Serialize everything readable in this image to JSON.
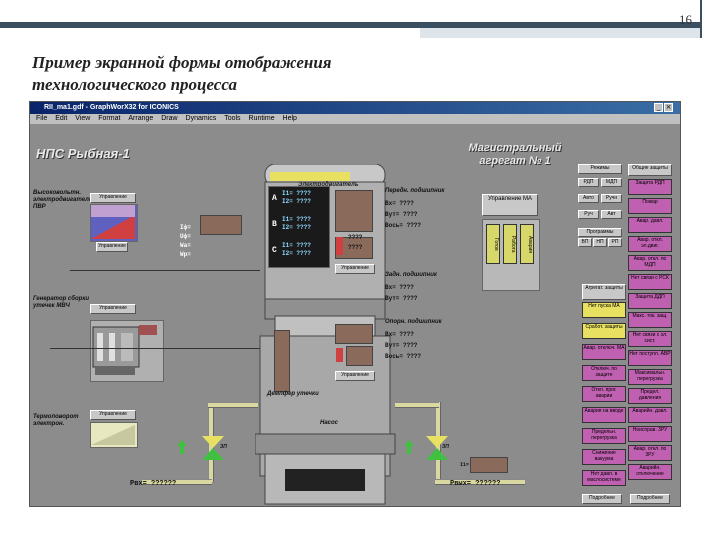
{
  "slide": {
    "number": "16",
    "title_line1": "Пример экранной формы отображения",
    "title_line2": "технологического процесса"
  },
  "window": {
    "title": "RII_ma1.gdf - GraphWorX32 for ICONICS"
  },
  "menu": [
    "File",
    "Edit",
    "View",
    "Format",
    "Arrange",
    "Draw",
    "Dynamics",
    "Tools",
    "Runtime",
    "Help"
  ],
  "labels": {
    "station": "НПС Рыбная-1",
    "aggregate": "Магистральный агрегат № 1",
    "electromotor": "Электродвигатель",
    "pump": "Насос",
    "bearing_front": "Передн. подшипник",
    "bearing_rear": "Задн. подшипник",
    "bearing_opor": "Опорн. подшипник",
    "damper": "Демпфер утечки",
    "left1": "Высоковольтн. электродвигатель ПВР",
    "left2": "Генератор сборки утечек МВЧ",
    "left3": "Термоповорот электрон.",
    "rvx": "Рвх= ??????",
    "rvyx": "Рвых= ??????",
    "control": "Управление",
    "control_ma": "Управление МА",
    "unknown": "????",
    "hint": "I1=",
    "pipe_label": "ЗП",
    "pipe_label2": "ЗП"
  },
  "electro_vals": {
    "I": "Iф=",
    "U": "Uф=",
    "W": "Wa=",
    "Wp": "Wp="
  },
  "phases": [
    {
      "name": "A",
      "v1": "I1= ????",
      "v2": "I2= ????"
    },
    {
      "name": "B",
      "v1": "I1= ????",
      "v2": "I2= ????"
    },
    {
      "name": "C",
      "v1": "I1= ????",
      "v2": "I2= ????"
    }
  ],
  "bearing_vals": [
    "Вх= ????",
    "Вут= ????",
    "Вось= ????"
  ],
  "bearing_vals2": [
    "Вх= ????",
    "Вут= ????"
  ],
  "bearing_vals3": [
    "Вх= ????",
    "Вут= ????",
    "Вось= ????"
  ],
  "ma_status": [
    "Готов",
    "Работа",
    "Авария"
  ],
  "regimes_title": "Режимы",
  "regimes": [
    "РДП",
    "МДП",
    "Авто",
    "Ручн",
    "Руч",
    "Авт"
  ],
  "programs_title": "Программы",
  "programs": [
    "ВП",
    "НП",
    "РП"
  ],
  "aggregate_states_title": "Агрегат. защиты",
  "aggregate_states": [
    "Нет пуска МА",
    "Сработ. защиты",
    "Авар. отключ. МА",
    "Отключ. по защите",
    "Откл. прог. аварии",
    "Авария на вводе",
    "Предельн. перегрузка",
    "Снижение вакуума",
    "Нет давл. в маслосистеме"
  ],
  "right_col_title": "Общие защиты",
  "right_col": [
    "Защита РДП",
    "Пожар",
    "Авар. давл.",
    "Авар. откл. эл.двиг.",
    "Авар. откл. по МДП",
    "Нет связи с РСК",
    "Защита ДДП",
    "Макс. ток. защ.",
    "Нет связи с эл. сист.",
    "Нет поступл. АВР",
    "Максимальн. перегрузка",
    "Предел. давления",
    "Аварийн. давл.",
    "Неисправ. 3РУ",
    "Авар. откл. по 3РУ",
    "Аварийн. отключение"
  ],
  "bottom_buttons": [
    "Подробнее",
    "Подробнее"
  ],
  "colors": {
    "canvas": "#8c8c8c",
    "accent": "#c060b0",
    "yellow": "#e8e060",
    "green": "#40c040",
    "red": "#d04040"
  }
}
